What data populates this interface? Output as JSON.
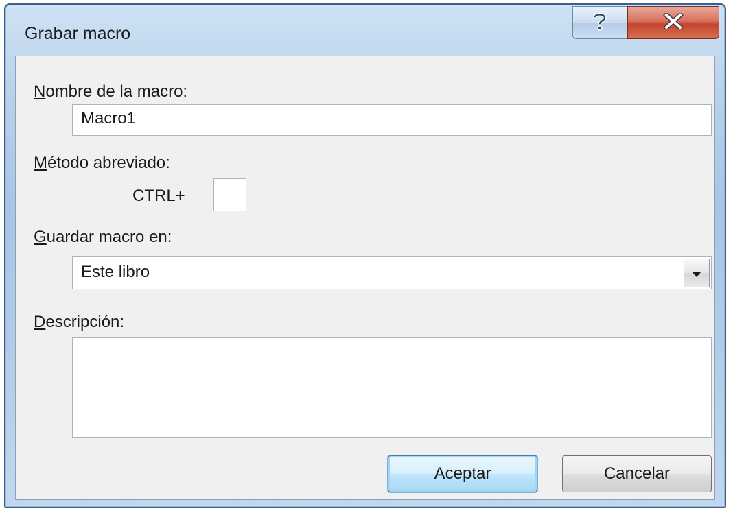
{
  "window": {
    "title": "Grabar macro",
    "help_icon": "help-icon",
    "close_icon": "close-icon"
  },
  "form": {
    "name_label": {
      "underlined": "N",
      "rest": "ombre de la macro:"
    },
    "name_value": "Macro1",
    "shortcut_label": {
      "underlined": "M",
      "rest": "étodo abreviado:"
    },
    "shortcut_prefix": "CTRL+",
    "shortcut_value": "",
    "store_label": {
      "underlined": "G",
      "rest": "uardar macro en:"
    },
    "store_value": "Este libro",
    "description_label": {
      "underlined": "D",
      "rest": "escripción:"
    },
    "description_value": ""
  },
  "buttons": {
    "ok": "Aceptar",
    "cancel": "Cancelar"
  },
  "colors": {
    "titlebar": "#b9d1ea",
    "close_button": "#c4452d",
    "client_bg": "#f0f0f0",
    "default_button_border": "#3c7fb1"
  }
}
